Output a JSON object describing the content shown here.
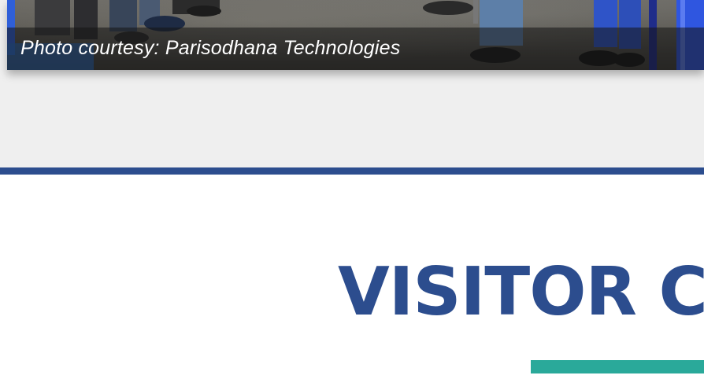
{
  "photo": {
    "caption": "Photo courtesy: Parisodhana Technologies"
  },
  "section": {
    "heading": "VISITOR CH"
  },
  "colors": {
    "band_background": "#efefef",
    "rule": "#2c4d8e",
    "heading": "#2c4d8e",
    "accent": "#2aa99a"
  }
}
